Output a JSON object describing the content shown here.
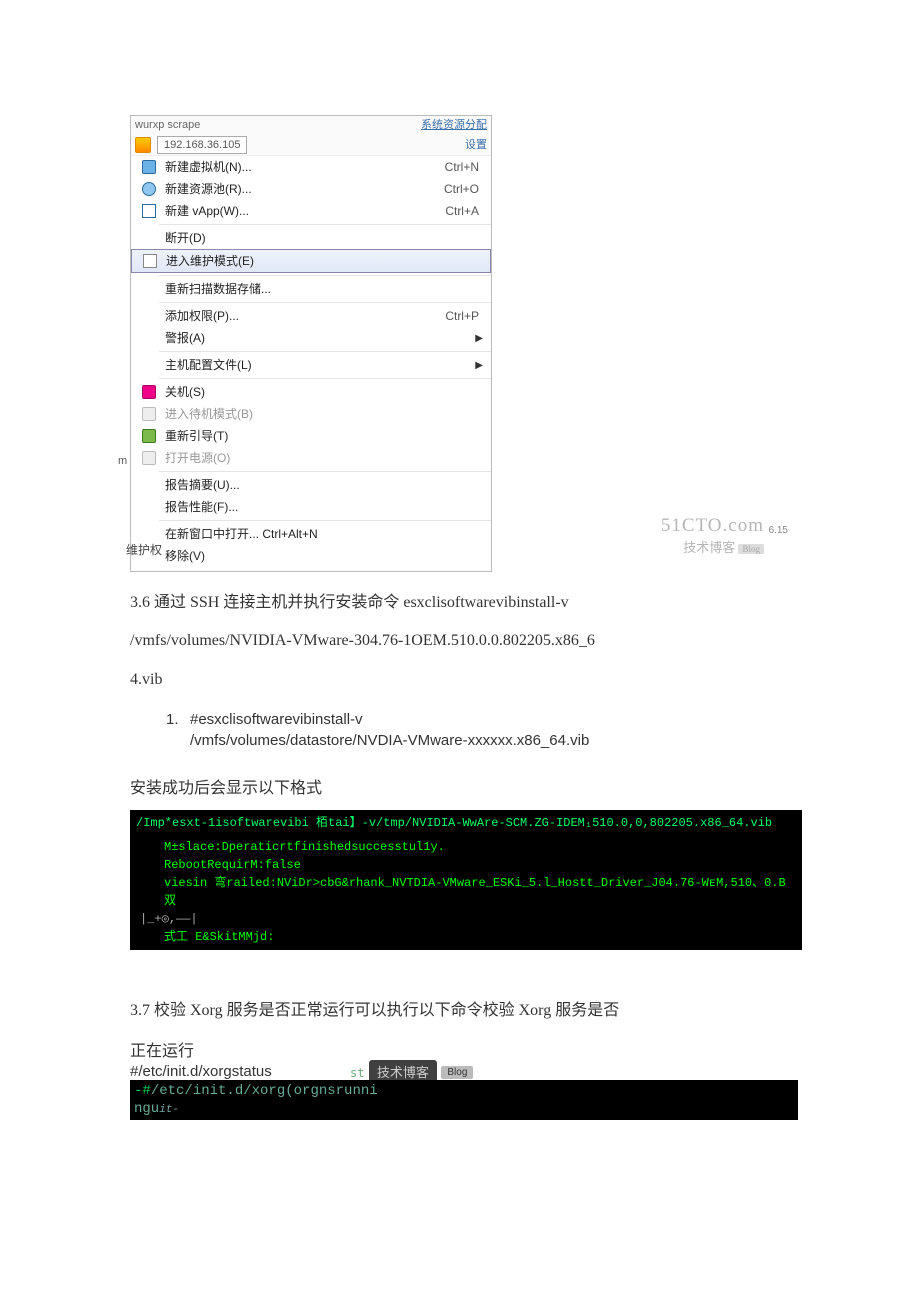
{
  "screenshot1": {
    "top_partial": "wurxp scrape",
    "sys_link": "系统资源分配",
    "ip_text": "192.168.36.105",
    "side_settings": "设置",
    "menu": [
      {
        "icon": "box-blue",
        "label": "新建虚拟机(N)...",
        "shortcut": "Ctrl+N"
      },
      {
        "icon": "box-globe",
        "label": "新建资源池(R)...",
        "shortcut": "Ctrl+O"
      },
      {
        "icon": "box-grid",
        "label": "新建 vApp(W)...",
        "shortcut": "Ctrl+A"
      },
      {
        "sep": true
      },
      {
        "label": "断开(D)"
      },
      {
        "icon": "box-img",
        "label": "进入维护模式(E)",
        "highlight": true
      },
      {
        "sep": true
      },
      {
        "label": "重新扫描数据存储..."
      },
      {
        "sep": true
      },
      {
        "label": "添加权限(P)...",
        "shortcut": "Ctrl+P"
      },
      {
        "label": "警报(A)",
        "arrow": true
      },
      {
        "sep": true
      },
      {
        "label": "主机配置文件(L)",
        "arrow": true
      },
      {
        "sep": true
      },
      {
        "icon": "box-red",
        "label": "关机(S)"
      },
      {
        "icon": "box-gray",
        "label": "进入待机模式(B)",
        "disabled": true
      },
      {
        "icon": "box-green",
        "label": "重新引导(T)"
      },
      {
        "icon": "box-gray",
        "label": "打开电源(O)",
        "disabled": true
      },
      {
        "sep": true
      },
      {
        "label": "报告摘要(U)..."
      },
      {
        "label": "报告性能(F)..."
      },
      {
        "sep": true
      },
      {
        "label": "在新窗口中打开... Ctrl+Alt+N"
      },
      {
        "label": "移除(V)"
      }
    ],
    "side_label": "维护权",
    "side_m": "m",
    "wm_big": "51CTO.com",
    "wm_sub": "技术博客",
    "wm_blog": "Blog",
    "wm_num": "6.15"
  },
  "sec36": {
    "line1": "3.6 通过 SSH 连接主机并执行安装命令 esxclisoftwarevibinstall-v",
    "line2": "/vmfs/volumes/NVIDIA-VMware-304.76-1OEM.510.0.0.802205.x86_6",
    "line3": "4.vib"
  },
  "codelist": {
    "num": "1.",
    "l1": "#esxclisoftwarevibinstall-v",
    "l2": "/vmfs/volumes/datastore/NVDIA-VMware-xxxxxx.x86_64.vib"
  },
  "succ_text": "安装成功后会显示以下格式",
  "term1": {
    "l1": "/Imp*esxt-1isoftwarevibi 栢tai】-v/tmp/NVIDIA-WwAre-SCM.ZG-IDEM₁510.0,0,802205.x86_64.vib",
    "l2": "M±slace:Dperaticrtfinishedsuccesstul1y.",
    "l3": "RebootRequirM:false",
    "l4": "viesin 弯railed:NViDr>cbG&rhank_NVTDIA-VMware_ESKi_5.l_Hostt_Driver_J04.76-WᴇM,510、0.B 双",
    "l5": "|_+◎,——|",
    "l6": "式工 E&SkitMMjd:"
  },
  "sec37": {
    "line1": "3.7 校验 Xorg 服务是否正常运行可以执行以下命令校验 Xorg 服务是否",
    "line2": "正在运行",
    "cmd": "#/etc/init.d/xorgstatus"
  },
  "wm2": {
    "tag": "技术博客",
    "blog": "Blog",
    "prefix": "st"
  },
  "term2": {
    "l1a": "-#",
    "l1b": "/etc/init.d/xorg(orgnsrunni",
    "l2a": "ngu",
    "l2b": "it-"
  }
}
